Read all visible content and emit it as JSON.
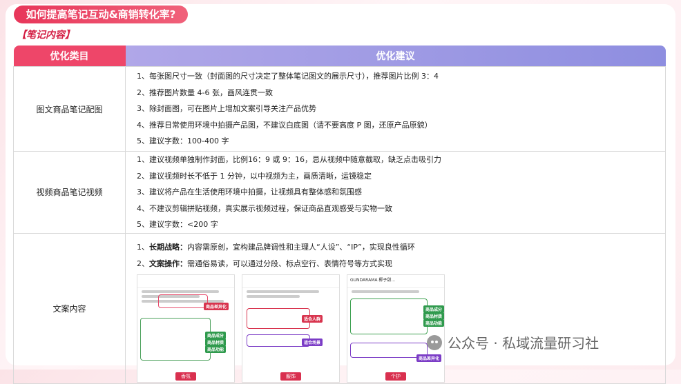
{
  "title": "如何提高笔记互动&商销转化率?",
  "section_label": "【笔记内容】",
  "table": {
    "headers": [
      "优化类目",
      "优化建议"
    ],
    "rows": [
      {
        "category": "图文商品笔记配图",
        "lines": [
          "1、每张图尺寸一致（封面图的尺寸决定了整体笔记图文的展示尺寸），推荐图片比例 3：4",
          "2、推荐图片数量 4-6 张，画风连贯一致",
          "3、除封面图，可在图片上增加文案引导关注产品优势",
          "4、推荐日常使用环境中拍摄产品图，不建议白底图（请不要高度 P 图，还原产品原貌）",
          "5、建议字数：100-400 字"
        ]
      },
      {
        "category": "视频商品笔记视频",
        "lines": [
          "1、建议视频单独制作封面，比例16：9 或 9：16，忌从视频中随意截取，缺乏点击吸引力",
          "2、建议视频时长不低于 1 分钟，以中视频为主，画质清晰，运镜稳定",
          "3、建议将产品在生活使用环境中拍摄，让视频具有整体感和氛围感",
          "4、不建议剪辑拼贴视频，真实展示视频过程，保证商品直观感受与实物一致",
          "5、建议字数：<200 字"
        ]
      },
      {
        "category": "文案内容",
        "lines": [
          {
            "prefix": "1、",
            "bold": "长期战略：",
            "text": "内容需原创，宜构建品牌调性和主理人“人设”、“IP”，实现良性循环"
          },
          {
            "prefix": "2、",
            "bold": "文案操作：",
            "text": "需通俗易读，可以通过分段、标点空行、表情符号等方式实现"
          }
        ],
        "screenshots": [
          {
            "tags": [
              "商品差异化",
              "商品成分",
              "商品材质",
              "商品功能"
            ],
            "footer": "香氛"
          },
          {
            "tags": [
              "适合人群",
              "适合场景"
            ],
            "footer": "服饰"
          },
          {
            "header": "GUNDARAMA 椰子甜...",
            "tags": [
              "商品成分",
              "商品材质",
              "商品功能",
              "商品差异化"
            ],
            "footer": "个护"
          }
        ]
      }
    ]
  },
  "watermark": "公众号 · 私域流量研习社",
  "colors": {
    "accent": "#ee4669",
    "header_purple": "#9f98e4"
  }
}
